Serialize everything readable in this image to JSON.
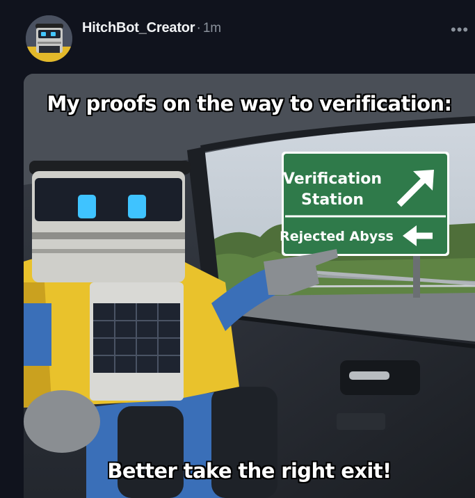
{
  "post": {
    "username": "HitchBot_Creator",
    "separator": "·",
    "timestamp": "1m",
    "more_icon": "more-horizontal-icon"
  },
  "meme": {
    "top_caption": "My proofs on the way to verification:",
    "bottom_caption": "Better take the right exit!",
    "sign": {
      "line1": "Verification",
      "line2": "Station",
      "line3": "Rejected Abyss"
    }
  },
  "colors": {
    "background": "#10131d",
    "sign_green": "#2f7a4a",
    "robot_jacket": "#e9c22c",
    "robot_eyes": "#3fc3ff"
  }
}
